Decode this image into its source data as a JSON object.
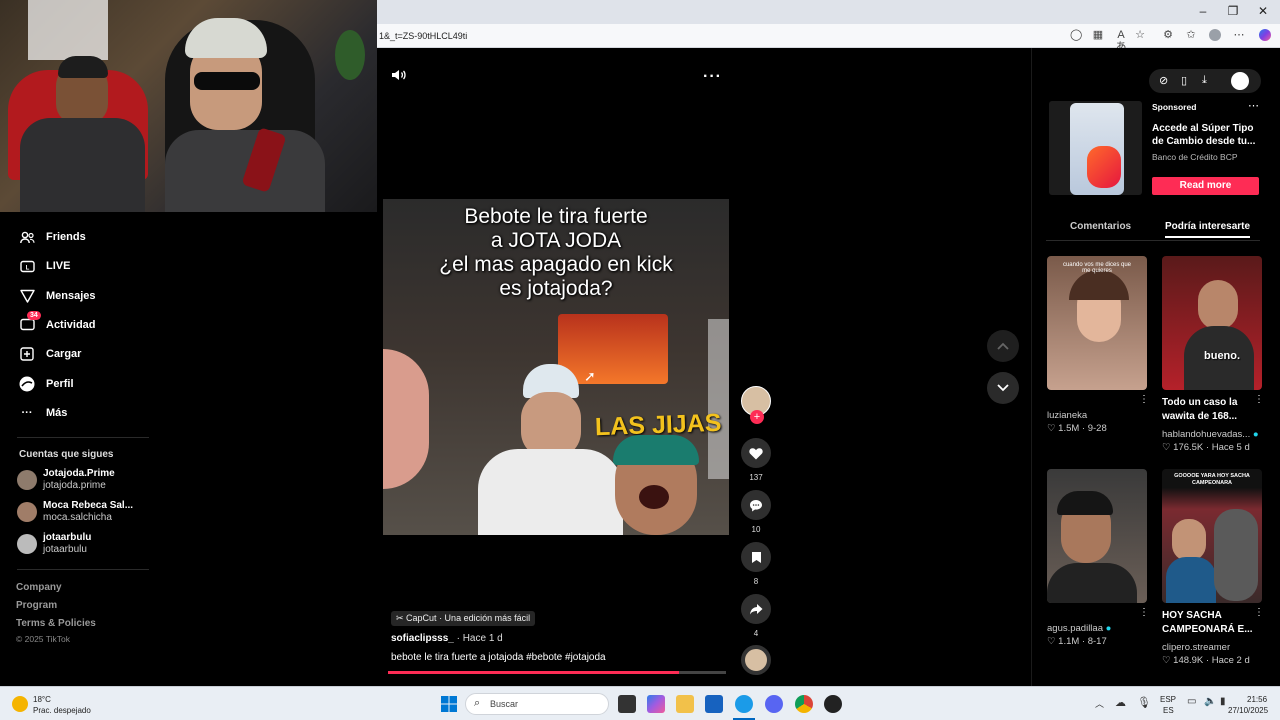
{
  "browser": {
    "url": "1&_t=ZS-90tHLCL49ti",
    "window_controls": {
      "minimize": "–",
      "restore": "❐",
      "close": "✕"
    }
  },
  "sidebar": {
    "nav": [
      {
        "label": "Friends",
        "icon": "friends-icon"
      },
      {
        "label": "LIVE",
        "icon": "live-icon"
      },
      {
        "label": "Mensajes",
        "icon": "messages-icon"
      },
      {
        "label": "Actividad",
        "icon": "activity-icon",
        "badge": "34"
      },
      {
        "label": "Cargar",
        "icon": "upload-icon"
      },
      {
        "label": "Perfil",
        "icon": "profile-icon"
      },
      {
        "label": "Más",
        "icon": "more-icon"
      }
    ],
    "following_title": "Cuentas que sigues",
    "following": [
      {
        "name": "Jotajoda.Prime",
        "handle": "jotajoda.prime"
      },
      {
        "name": "Moca Rebeca Sal...",
        "handle": "moca.salchicha"
      },
      {
        "name": "jotaarbulu",
        "handle": "jotaarbulu"
      }
    ],
    "footer": {
      "company": "Company",
      "program": "Program",
      "terms": "Terms & Policies",
      "copyright": "© 2025 TikTok"
    }
  },
  "video": {
    "caption": [
      "Bebote le tira fuerte",
      "a JOTA JODA",
      "¿el mas apagado en kick",
      "es jotajoda?"
    ],
    "overlay_text": "LAS JIJAS",
    "capcut": "CapCut · Una edición más fácil",
    "author": "sofiaclipsss_",
    "time": "· Hace 1 d",
    "description": "bebote le tira fuerte a jotajoda #bebote  #jotajoda",
    "progress": 0.86,
    "likes": "137",
    "comments": "10",
    "saves": "8",
    "shares": "4"
  },
  "ad": {
    "label": "Sponsored",
    "title_line1": "Accede al Súper Tipo",
    "title_line2": "de Cambio desde tu...",
    "advertiser": "Banco de Crédito BCP",
    "cta": "Read more"
  },
  "tabs": {
    "comments": "Comentarios",
    "suggested": "Podría interesarte"
  },
  "suggestions": [
    {
      "title": "",
      "author": "luzianeka",
      "likes": "1.5M",
      "date": "· 9-28",
      "overlay": "cuando vos me dices que me quieres"
    },
    {
      "title_line1": "Todo un caso la",
      "title_line2": "wawita de 168...",
      "author": "hablandohuevadas...",
      "likes": "176.5K",
      "date": "· Hace 5 d",
      "overlay": "bueno."
    },
    {
      "title": "",
      "author": "agus.padillaa",
      "likes": "1.1M",
      "date": "· 8-17"
    },
    {
      "title_line1": "HOY SACHA",
      "title_line2": "CAMPEONARÁ E...",
      "author": "clipero.streamer",
      "likes": "148.9K",
      "date": "· Hace 2 d",
      "overlay": "GOOOOE YARA HOY SACHA CAMPEONARA"
    }
  ],
  "taskbar": {
    "temp": "18°C",
    "weather": "Prac. despejado",
    "search": "Buscar",
    "lang1": "ESP",
    "lang2": "ES",
    "time": "21:56",
    "date": "27/10/2025"
  }
}
